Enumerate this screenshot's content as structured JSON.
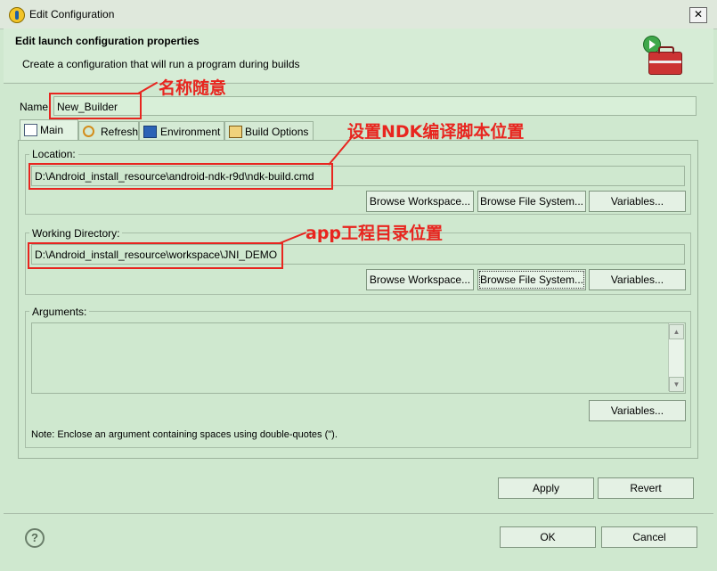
{
  "window": {
    "title": "Edit Configuration",
    "close_glyph": "✕"
  },
  "header": {
    "title": "Edit launch configuration properties",
    "subtitle": "Create a configuration that will run a program during builds"
  },
  "name": {
    "label": "Name",
    "value": "New_Builder"
  },
  "tabs": [
    {
      "label": "Main",
      "icon": "main-tab-icon",
      "active": true
    },
    {
      "label": "Refresh",
      "icon": "refresh-icon",
      "active": false
    },
    {
      "label": "Environment",
      "icon": "environment-icon",
      "active": false
    },
    {
      "label": "Build Options",
      "icon": "build-options-icon",
      "active": false
    }
  ],
  "location": {
    "label": "Location:",
    "value": "D:\\Android_install_resource\\android-ndk-r9d\\ndk-build.cmd",
    "buttons": [
      "Browse Workspace...",
      "Browse File System...",
      "Variables..."
    ]
  },
  "working_dir": {
    "label": "Working Directory:",
    "value": "D:\\Android_install_resource\\workspace\\JNI_DEMO",
    "buttons": [
      "Browse Workspace...",
      "Browse File System...",
      "Variables..."
    ]
  },
  "arguments": {
    "label": "Arguments:",
    "value": "",
    "variables_button": "Variables...",
    "note": "Note: Enclose an argument containing spaces using double-quotes (\")."
  },
  "panel_buttons": {
    "apply": "Apply",
    "revert": "Revert"
  },
  "dialog_buttons": {
    "ok": "OK",
    "cancel": "Cancel",
    "help": "?"
  },
  "annotations": {
    "name": "名称随意",
    "location": "设置NDK编译脚本位置",
    "working_dir": "app工程目录位置",
    "color": "#e8251f"
  },
  "colors": {
    "background": "#cfe8cf",
    "annotation": "#e8251f"
  }
}
